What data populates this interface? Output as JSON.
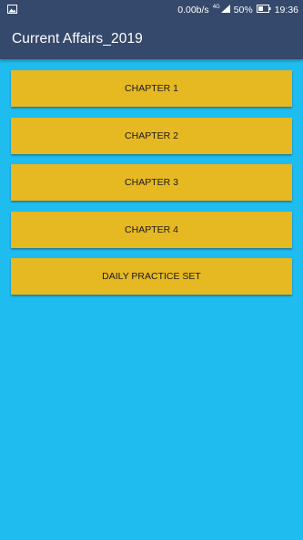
{
  "status_bar": {
    "network_speed": "0.00b/s",
    "network_type": "4G",
    "battery_percent": "50%",
    "time": "19:36",
    "icons": [
      "image-notification-icon",
      "signal-icon",
      "battery-icon"
    ]
  },
  "app_bar": {
    "title": "Current Affairs_2019"
  },
  "menu": {
    "items": [
      {
        "label": "CHAPTER 1"
      },
      {
        "label": "CHAPTER 2"
      },
      {
        "label": "CHAPTER 3"
      },
      {
        "label": "CHAPTER 4"
      },
      {
        "label": "DAILY PRACTICE SET"
      }
    ]
  },
  "colors": {
    "status_bar": "#34496b",
    "app_bar": "#34496b",
    "background": "#1fbcf0",
    "button": "#e6b822",
    "button_text": "#1a1a1a"
  }
}
